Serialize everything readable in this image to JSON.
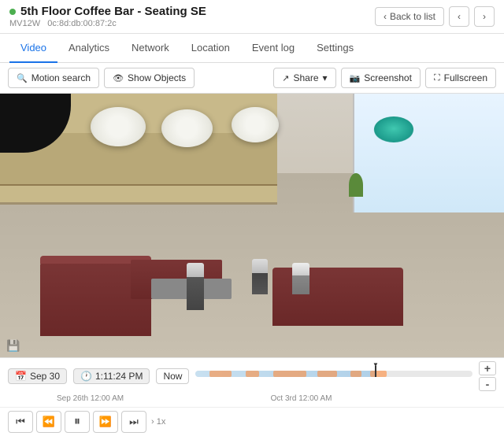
{
  "titleBar": {
    "title": "5th Floor Coffee Bar - Seating SE",
    "deviceId": "MV12W",
    "mac": "0c:8d:db:00:87:2c",
    "backLabel": "Back to list"
  },
  "tabs": [
    {
      "id": "video",
      "label": "Video",
      "active": true
    },
    {
      "id": "analytics",
      "label": "Analytics",
      "active": false
    },
    {
      "id": "network",
      "label": "Network",
      "active": false
    },
    {
      "id": "location",
      "label": "Location",
      "active": false
    },
    {
      "id": "eventlog",
      "label": "Event log",
      "active": false
    },
    {
      "id": "settings",
      "label": "Settings",
      "active": false
    }
  ],
  "toolbar": {
    "motionSearch": "Motion search",
    "showObjects": "Show Objects",
    "share": "Share",
    "screenshot": "Screenshot",
    "fullscreen": "Fullscreen"
  },
  "timeline": {
    "date": "Sep 30",
    "time": "1:11:24 PM",
    "nowLabel": "Now",
    "leftLabel": "Sep 26th 12:00 AM",
    "rightLabel": "Oct 3rd 12:00 AM",
    "plusLabel": "+",
    "minusLabel": "-"
  },
  "controls": {
    "speed": "1x"
  },
  "icons": {
    "calendar": "📅",
    "clock": "🕐",
    "share": "↗",
    "screenshot": "📷",
    "fullscreen": "⛶",
    "motionSearch": "🔍",
    "eye": "👁",
    "back": "‹",
    "prevArrow": "‹",
    "nextArrow": "›",
    "skipBack": "⏮",
    "rewind": "⏪",
    "play": "⏸",
    "fastForward": "⏩",
    "skipForward": "⏭",
    "camera": "📷",
    "sdCard": "💾"
  }
}
